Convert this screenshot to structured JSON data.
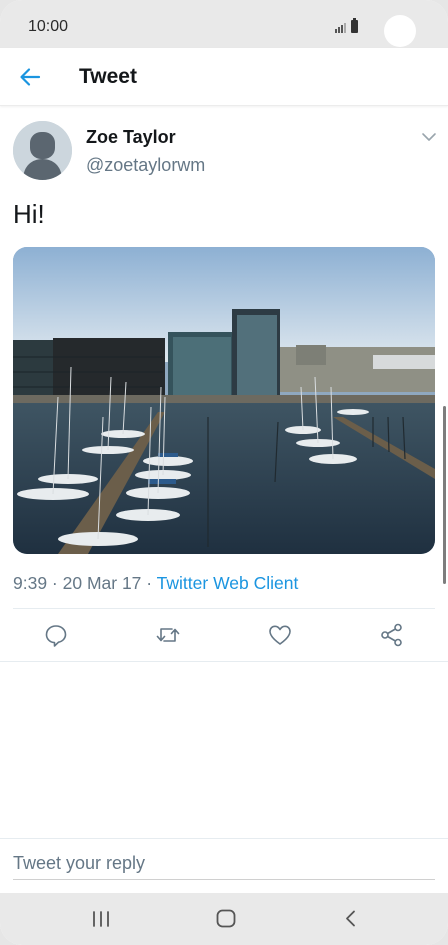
{
  "status_bar": {
    "time": "10:00"
  },
  "app_bar": {
    "title": "Tweet",
    "back_icon": "arrow-left-icon"
  },
  "tweet": {
    "author_name": "Zoe Taylor",
    "author_handle": "@zoetaylorwm",
    "text": "Hi!",
    "media_alt": "harbor-photo",
    "time": "9:39",
    "date": "20 Mar 17",
    "separator": " · ",
    "source": "Twitter Web Client"
  },
  "actions": [
    {
      "name": "reply",
      "icon": "comment-icon"
    },
    {
      "name": "retweet",
      "icon": "retweet-icon"
    },
    {
      "name": "like",
      "icon": "heart-icon"
    },
    {
      "name": "share",
      "icon": "share-icon"
    }
  ],
  "reply": {
    "placeholder": "Tweet your reply"
  },
  "nav_bar": {
    "recents_icon": "recents-icon",
    "home_icon": "home-icon",
    "back_icon": "back-chevron-icon"
  },
  "colors": {
    "accent": "#1b95e0",
    "text": "#14171a",
    "secondary": "#657786"
  }
}
